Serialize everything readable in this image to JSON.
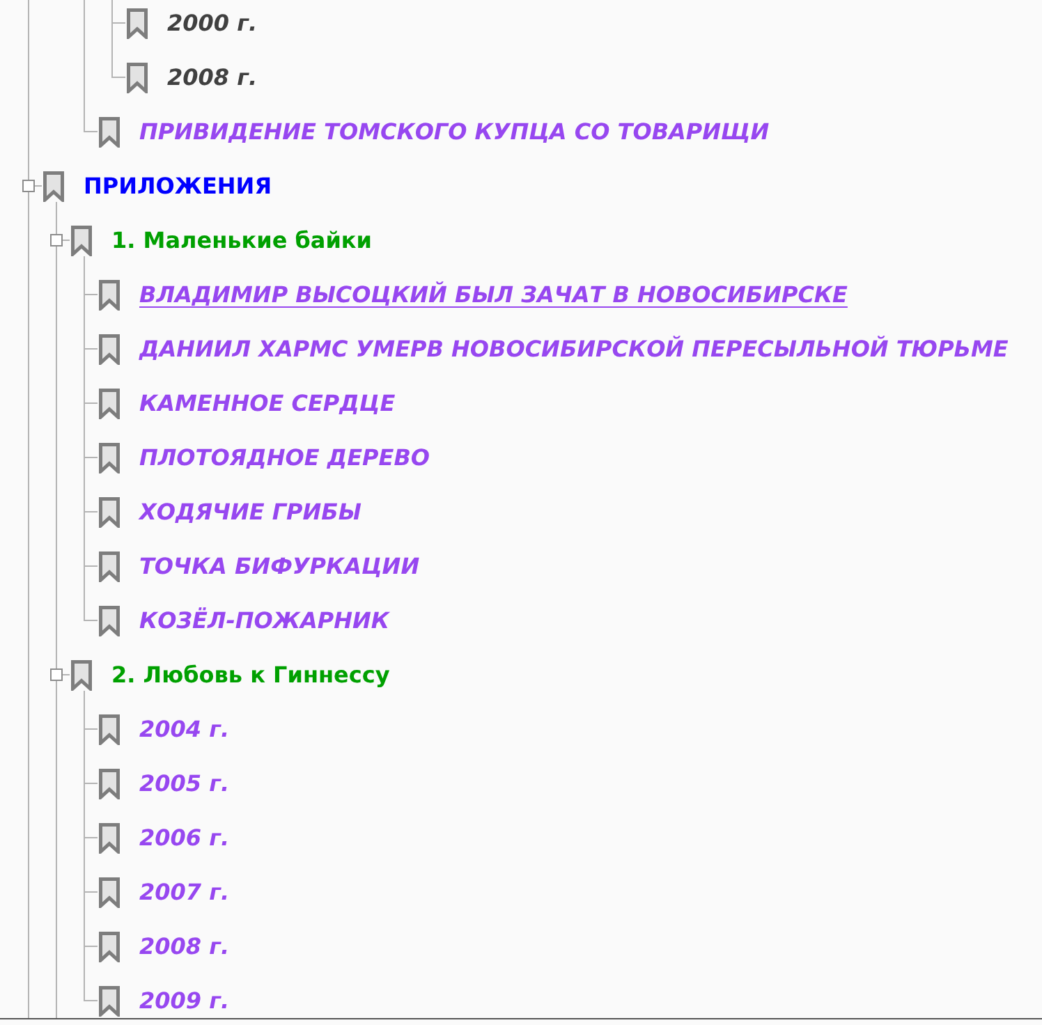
{
  "bookmarks": [
    {
      "children": [
        {
          "children": [
            {
              "children": [
                {
                  "title": "2000 г.",
                  "color": "#404040",
                  "italic": true,
                  "hovered": false
                },
                {
                  "title": "2008 г.",
                  "color": "#404040",
                  "italic": true,
                  "hovered": false
                }
              ]
            },
            {
              "title": "ПРИВИДЕНИЕ ТОМСКОГО КУПЦА СО ТОВАРИЩИ",
              "color": "#9747f0",
              "italic": true,
              "hovered": false
            }
          ]
        }
      ]
    },
    {
      "title": "ПРИЛОЖЕНИЯ",
      "color": "#0000ff",
      "italic": false,
      "hovered": false,
      "expanded": true,
      "more_children_below": true,
      "children": [
        {
          "title": "1. Маленькие байки",
          "color": "#00a000",
          "italic": false,
          "hovered": false,
          "expanded": true,
          "children": [
            {
              "title": "ВЛАДИМИР ВЫСОЦКИЙ БЫЛ ЗАЧАТ В НОВОСИБИРСКЕ",
              "color": "#9747f0",
              "italic": true,
              "hovered": true
            },
            {
              "title": "ДАНИИЛ ХАРМС УМЕРВ НОВОСИБИРСКОЙ ПЕРЕСЫЛЬНОЙ ТЮРЬМЕ",
              "color": "#9747f0",
              "italic": true,
              "hovered": false
            },
            {
              "title": "КАМЕННОЕ СЕРДЦЕ",
              "color": "#9747f0",
              "italic": true,
              "hovered": false
            },
            {
              "title": "ПЛОТОЯДНОЕ ДЕРЕВО",
              "color": "#9747f0",
              "italic": true,
              "hovered": false
            },
            {
              "title": "ХОДЯЧИЕ ГРИБЫ",
              "color": "#9747f0",
              "italic": true,
              "hovered": false
            },
            {
              "title": "ТОЧКА БИФУРКАЦИИ",
              "color": "#9747f0",
              "italic": true,
              "hovered": false
            },
            {
              "title": "КОЗЁЛ-ПОЖАРНИК",
              "color": "#9747f0",
              "italic": true,
              "hovered": false
            }
          ]
        },
        {
          "title": "2. Любовь к Гиннессу",
          "color": "#00a000",
          "italic": false,
          "hovered": false,
          "expanded": true,
          "children": [
            {
              "title": "2004 г.",
              "color": "#9747f0",
              "italic": true,
              "hovered": false
            },
            {
              "title": "2005 г.",
              "color": "#9747f0",
              "italic": true,
              "hovered": false
            },
            {
              "title": "2006 г.",
              "color": "#9747f0",
              "italic": true,
              "hovered": false
            },
            {
              "title": "2007 г.",
              "color": "#9747f0",
              "italic": true,
              "hovered": false
            },
            {
              "title": "2008 г.",
              "color": "#9747f0",
              "italic": true,
              "hovered": false
            },
            {
              "title": "2009 г.",
              "color": "#9747f0",
              "italic": true,
              "hovered": false
            }
          ]
        }
      ]
    }
  ],
  "bookmarks_more_below": true
}
